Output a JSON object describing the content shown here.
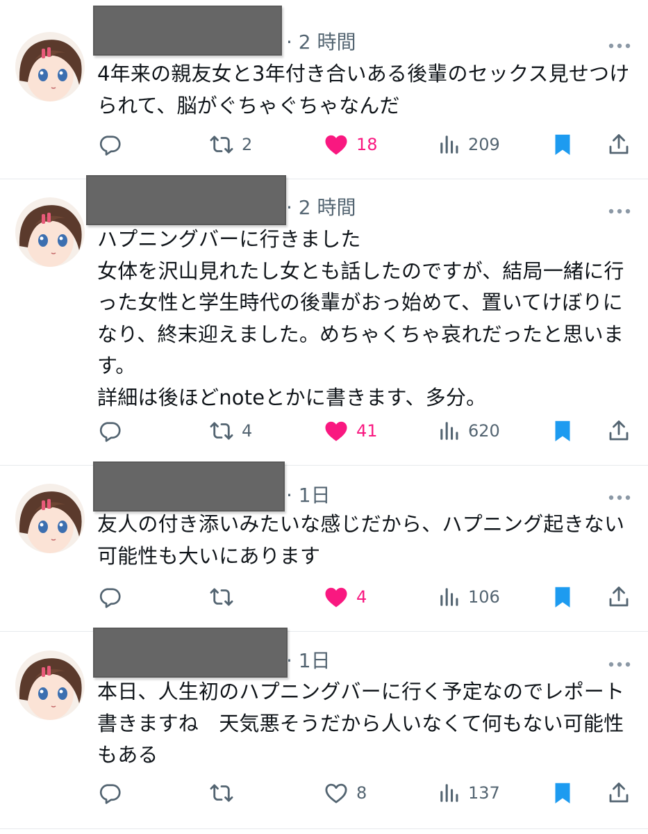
{
  "colors": {
    "like_active": "#f91880",
    "bookmark_active": "#1d9bf0",
    "muted": "#536471",
    "text": "#0f1419"
  },
  "tweets": [
    {
      "time": "· 2 時間",
      "text": "4年来の親友女と3年付き合いある後輩のセックス見せつけられて、脳がぐちゃぐちゃなんだ",
      "reply_count": "",
      "retweet_count": "2",
      "like_count": "18",
      "liked": true,
      "view_count": "209",
      "bookmarked": true
    },
    {
      "time": "· 2 時間",
      "text": "ハプニングバーに行きました\n女体を沢山見れたし女とも話したのですが、結局一緒に行った女性と学生時代の後輩がおっ始めて、置いてけぼりになり、終末迎えました。めちゃくちゃ哀れだったと思います。\n詳細は後ほどnoteとかに書きます、多分。",
      "reply_count": "",
      "retweet_count": "4",
      "like_count": "41",
      "liked": true,
      "view_count": "620",
      "bookmarked": true
    },
    {
      "time": "· 1日",
      "text": "友人の付き添いみたいな感じだから、ハプニング起きない可能性も大いにあります",
      "reply_count": "",
      "retweet_count": "",
      "like_count": "4",
      "liked": true,
      "view_count": "106",
      "bookmarked": true
    },
    {
      "time": "· 1日",
      "text": "本日、人生初のハプニングバーに行く予定なのでレポート書きますね　天気悪そうだから人いなくて何もない可能性もある",
      "reply_count": "",
      "retweet_count": "",
      "like_count": "8",
      "liked": false,
      "view_count": "137",
      "bookmarked": true
    }
  ]
}
